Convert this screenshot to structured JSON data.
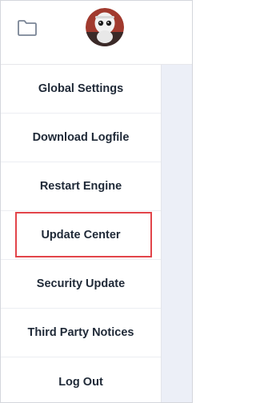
{
  "header": {
    "folder_icon": "folder-icon",
    "avatar_icon": "robot-avatar"
  },
  "menu": {
    "items": [
      {
        "label": "Global Settings"
      },
      {
        "label": "Download Logfile"
      },
      {
        "label": "Restart Engine"
      },
      {
        "label": "Update Center",
        "highlighted": true
      },
      {
        "label": "Security Update"
      },
      {
        "label": "Third Party Notices"
      },
      {
        "label": "Log Out"
      }
    ]
  },
  "colors": {
    "highlight_border": "#e2444a",
    "side_panel": "#eceff7",
    "text": "#1f2937"
  }
}
